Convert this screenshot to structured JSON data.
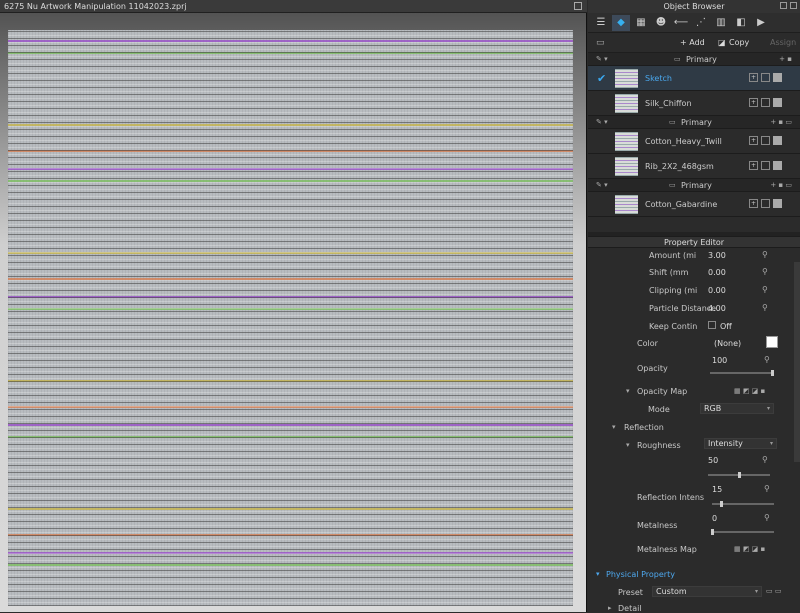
{
  "viewport": {
    "title": "6275 Nu Artwork Manipulation 11042023.zprj"
  },
  "object_browser": {
    "title": "Object Browser",
    "add_label": "+ Add",
    "copy_label": "Copy",
    "assign_label": "Assign",
    "group_label": "Primary",
    "items": [
      {
        "label": "Sketch",
        "selected": true
      },
      {
        "label": "Silk_Chiffon"
      },
      {
        "label": "Cotton_Heavy_Twill"
      },
      {
        "label": "Rib_2X2_468gsm"
      },
      {
        "label": "Cotton_Gabardine"
      }
    ]
  },
  "property_editor": {
    "title": "Property Editor",
    "amount_label": "Amount (mi",
    "amount_value": "3.00",
    "shift_label": "Shift (mm",
    "shift_value": "0.00",
    "clipping_label": "Clipping (mi",
    "clipping_value": "0.00",
    "particle_label": "Particle Distance",
    "particle_value": "4.00",
    "keep_label": "Keep Contin",
    "keep_value": "Off",
    "color_label": "Color",
    "color_value": "(None)",
    "opacity_label": "Opacity",
    "opacity_value": "100",
    "opacity_level": 1.0,
    "opacity_map_label": "Opacity Map",
    "mode_label": "Mode",
    "mode_value": "RGB",
    "reflection_label": "Reflection",
    "roughness_label": "Roughness",
    "roughness_value": "Intensity",
    "roughness_amount": "50",
    "roughness_level": 0.5,
    "refl_intensity_label": "Reflection Intens",
    "refl_intensity_value": "15",
    "refl_intensity_level": 0.15,
    "metalness_label": "Metalness",
    "metalness_value": "0",
    "metalness_map_label": "Metalness Map",
    "physical_label": "Physical Property",
    "preset_label": "Preset",
    "preset_value": "Custom",
    "detail_label": "Detail"
  },
  "colors": {
    "accent": "#36b0f0"
  }
}
